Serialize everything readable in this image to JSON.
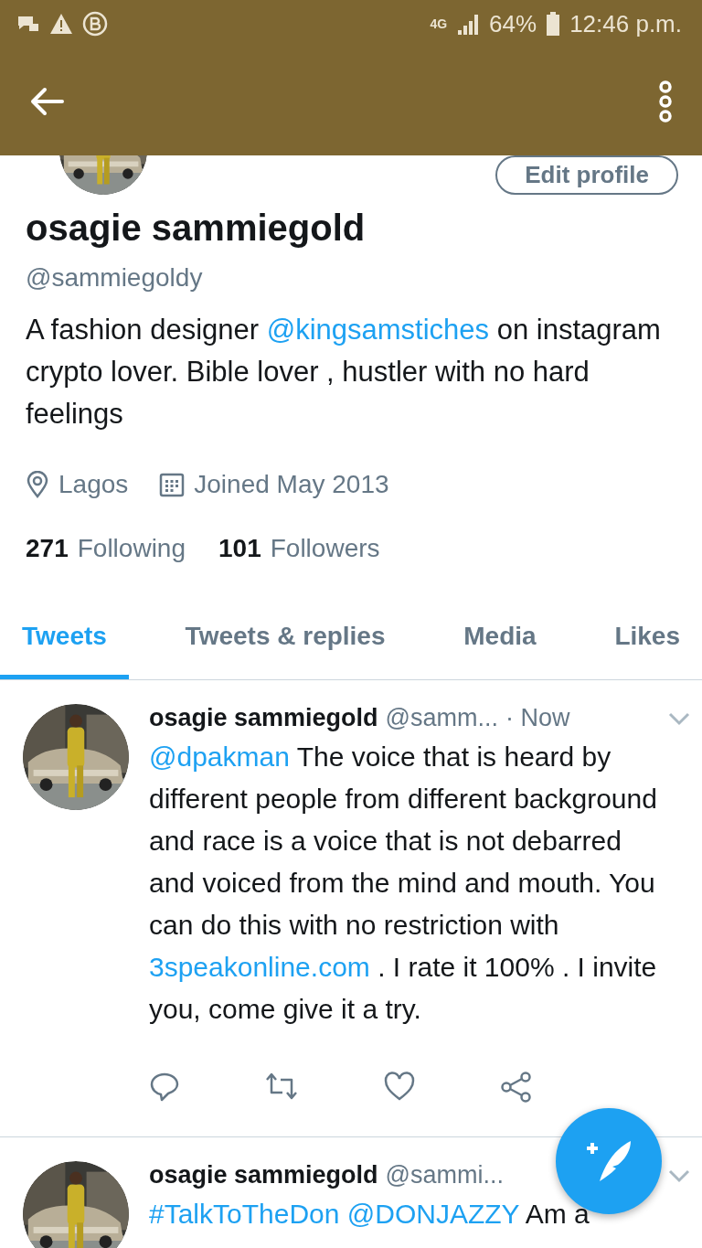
{
  "status_bar": {
    "network": "4G",
    "battery": "64%",
    "time": "12:46 p.m."
  },
  "profile": {
    "edit_button": "Edit profile",
    "name": "osagie sammiegold",
    "handle": "@sammiegoldy",
    "bio": [
      {
        "kind": "text",
        "text": "A fashion designer "
      },
      {
        "kind": "link",
        "text": "@kingsamstiches"
      },
      {
        "kind": "text",
        "text": " on instagram crypto lover. Bible lover , hustler with no hard feelings"
      }
    ],
    "location": "Lagos",
    "joined": "Joined May 2013",
    "following_count": "271",
    "following_label": "Following",
    "followers_count": "101",
    "followers_label": "Followers"
  },
  "tabs": [
    {
      "label": "Tweets",
      "selected": true
    },
    {
      "label": "Tweets & replies",
      "selected": false
    },
    {
      "label": "Media",
      "selected": false
    },
    {
      "label": "Likes",
      "selected": false
    }
  ],
  "tweets": [
    {
      "name": "osagie sammiegold",
      "handle": "@samm...",
      "time": "· Now",
      "text": [
        {
          "kind": "link",
          "text": "@dpakman"
        },
        {
          "kind": "text",
          "text": " The voice that is heard by different people from different background and race is a voice that is not debarred and voiced from the mind and mouth. You can do this with no restriction with "
        },
        {
          "kind": "link",
          "text": "3speakonline.com"
        },
        {
          "kind": "text",
          "text": " . I rate it 100% . I invite you, come give it a try."
        }
      ]
    },
    {
      "name": "osagie sammiegold",
      "handle": "@sammi...",
      "text": [
        {
          "kind": "link",
          "text": "#TalkToTheDon"
        },
        {
          "kind": "link",
          "text": "@DONJAZZY"
        },
        {
          "kind": "text",
          "text": " Am a"
        }
      ]
    }
  ]
}
